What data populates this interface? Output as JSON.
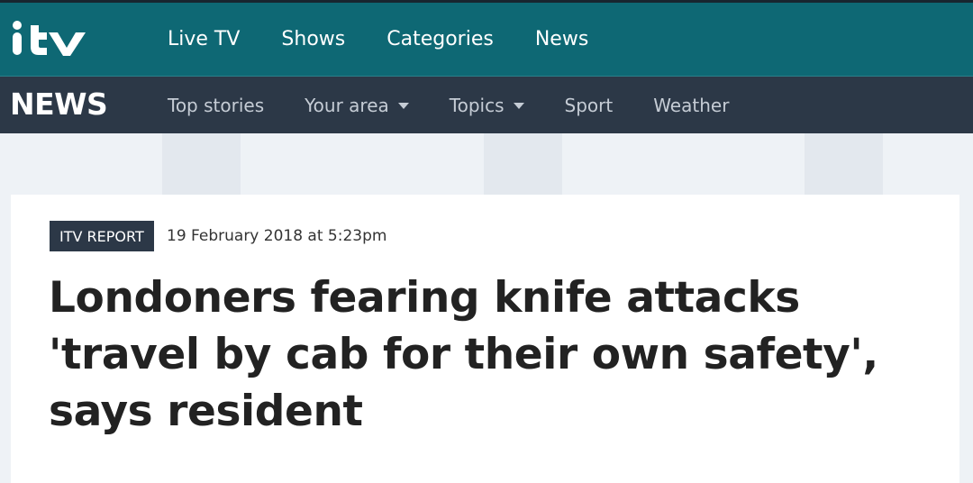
{
  "brand": {
    "logo_text": "itv",
    "section_logo": "NEWS"
  },
  "colors": {
    "top_nav_bg": "#0e6874",
    "sub_nav_bg": "#2c3847",
    "page_bg": "#eef2f6",
    "badge_bg": "#2c3847",
    "headline": "#222222"
  },
  "top_nav": {
    "items": [
      {
        "label": "Live TV"
      },
      {
        "label": "Shows"
      },
      {
        "label": "Categories"
      },
      {
        "label": "News"
      }
    ]
  },
  "sub_nav": {
    "items": [
      {
        "label": "Top stories",
        "dropdown": false
      },
      {
        "label": "Your area",
        "dropdown": true,
        "icon": "caret-down-icon"
      },
      {
        "label": "Topics",
        "dropdown": true,
        "icon": "caret-down-icon"
      },
      {
        "label": "Sport",
        "dropdown": false
      },
      {
        "label": "Weather",
        "dropdown": false
      }
    ]
  },
  "article": {
    "badge": "ITV REPORT",
    "date": "19 February 2018 at 5:23pm",
    "headline": "Londoners fearing knife attacks 'travel by cab for their own safety', says resident"
  }
}
